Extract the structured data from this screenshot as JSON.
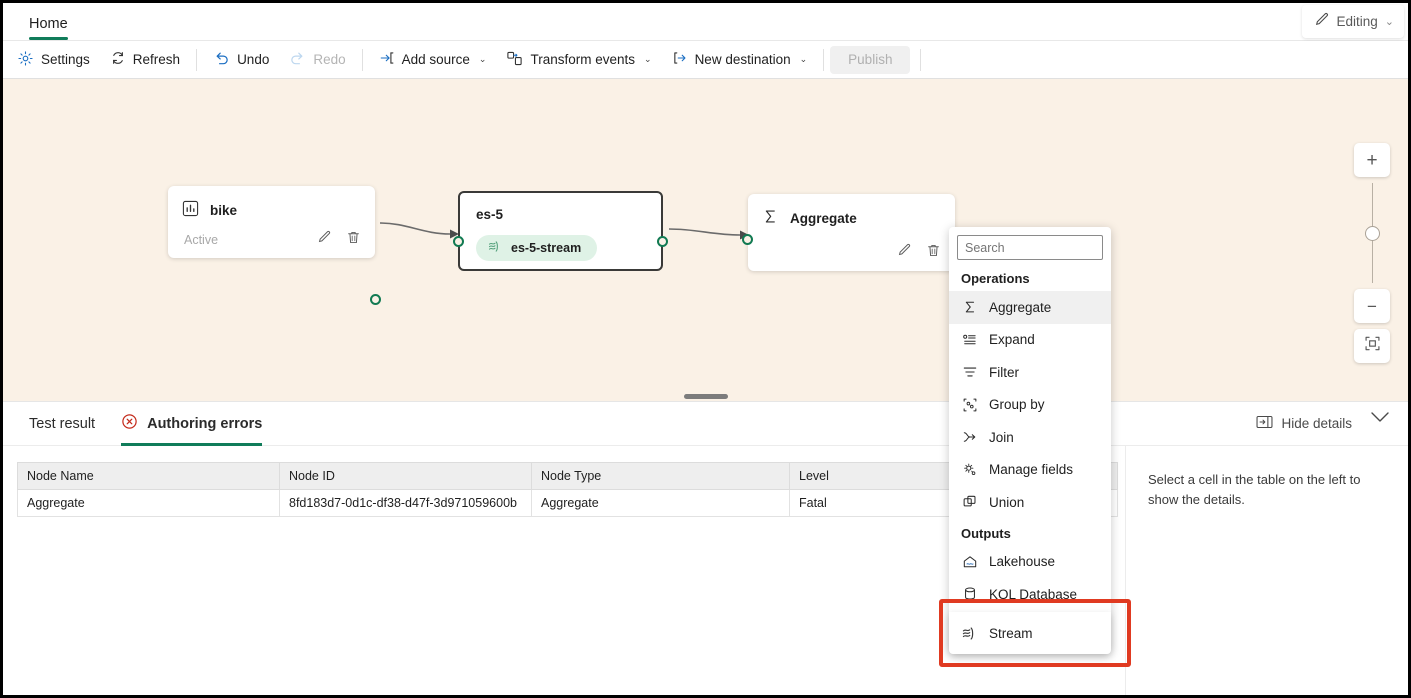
{
  "ribbon": {
    "tabs": [
      {
        "label": "Home",
        "active": true
      }
    ],
    "editing": {
      "label": "Editing",
      "icon": "pencil-icon",
      "chevron": "⌄"
    }
  },
  "toolbar": {
    "settings": "Settings",
    "refresh": "Refresh",
    "undo": "Undo",
    "redo": "Redo",
    "add_source": "Add source",
    "transform_events": "Transform events",
    "new_destination": "New destination",
    "publish": "Publish",
    "chevron": "⌄",
    "accent": "#1b6ec2"
  },
  "canvas": {
    "background": "#faf1e6",
    "port_color": "#117a52",
    "nodes": [
      {
        "id": "bike",
        "title": "bike",
        "icon": "chart-icon",
        "status": "Active",
        "type": "source"
      },
      {
        "id": "es-5",
        "title": "es-5",
        "pill": "es-5-stream",
        "pill_icon": "stream-icon",
        "type": "eventstream",
        "selected": true
      },
      {
        "id": "aggregate",
        "title": "Aggregate",
        "icon": "sigma-icon",
        "type": "operation"
      }
    ],
    "zoom_controls": {
      "zoom_in": "+",
      "zoom_out": "−",
      "fit_to_view": "fit-to-view-icon"
    }
  },
  "context_menu": {
    "search_placeholder": "Search",
    "search_value": "",
    "groups": [
      {
        "header": "Operations",
        "items": [
          {
            "label": "Aggregate",
            "icon": "sigma-icon",
            "highlighted": true
          },
          {
            "label": "Expand",
            "icon": "expand-icon",
            "highlighted": false
          },
          {
            "label": "Filter",
            "icon": "filter-icon",
            "highlighted": false
          },
          {
            "label": "Group by",
            "icon": "group-by-icon",
            "highlighted": false
          },
          {
            "label": "Join",
            "icon": "join-icon",
            "highlighted": false
          },
          {
            "label": "Manage fields",
            "icon": "manage-fields-icon",
            "highlighted": false
          },
          {
            "label": "Union",
            "icon": "union-icon",
            "highlighted": false
          }
        ]
      },
      {
        "header": "Outputs",
        "items": [
          {
            "label": "Lakehouse",
            "icon": "lakehouse-icon",
            "highlighted": false
          },
          {
            "label": "KQL Database",
            "icon": "database-icon",
            "highlighted": false
          }
        ]
      }
    ],
    "highlighted_item": {
      "label": "Stream",
      "icon": "stream-icon"
    },
    "highlight_color": "#e03a21"
  },
  "bottom_panel": {
    "tabs": [
      {
        "label": "Test result",
        "active": false,
        "icon": null
      },
      {
        "label": "Authoring errors",
        "active": true,
        "icon": "error-circle-icon"
      }
    ],
    "hide_details": "Hide details",
    "hide_details_icon": "panel-icon",
    "collapse_icon": "chevron-down-icon",
    "table": {
      "columns": [
        "Node Name",
        "Node ID",
        "Node Type",
        "Level"
      ],
      "rows": [
        [
          "Aggregate",
          "8fd183d7-0d1c-df38-d47f-3d971059600b",
          "Aggregate",
          "Fatal"
        ]
      ]
    },
    "details_placeholder": "Select a cell in the table on the left to show the details."
  }
}
